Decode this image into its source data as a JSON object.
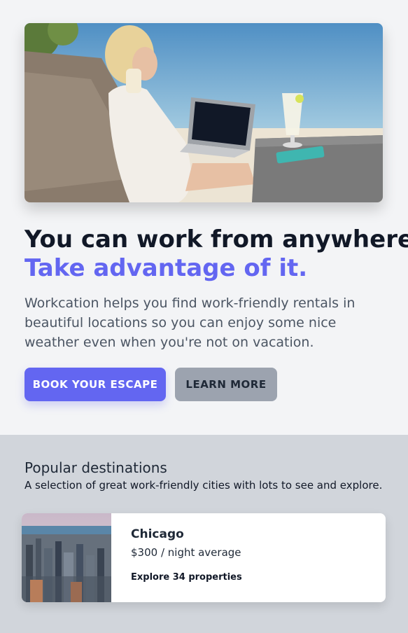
{
  "hero": {
    "headline": "You can work from anywhere.",
    "headline_accent": "Take advantage of it.",
    "description": "Workcation helps you find work-friendly rentals in beautiful locations so you can enjoy some nice weather even when you're not on vacation.",
    "primary_button": "Book your escape",
    "secondary_button": "Learn more"
  },
  "popular": {
    "title": "Popular destinations",
    "subtitle": "A selection of great work-friendly cities with lots to see and explore.",
    "destinations": [
      {
        "city": "Chicago",
        "price": "$300 / night average",
        "link": "Explore 34 properties"
      }
    ]
  },
  "colors": {
    "accent": "#6366f1",
    "secondary_button": "#9ca3af",
    "page_bg": "#f3f4f6",
    "section_bg": "#d1d5db"
  }
}
